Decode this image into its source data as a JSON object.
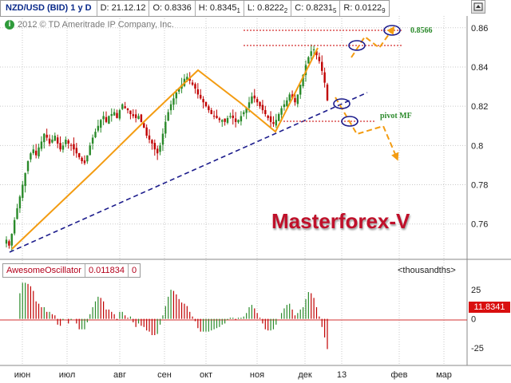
{
  "header": {
    "symbol": "NZD/USD (BID) 1 y D",
    "date": "D: 21.12.12",
    "open": "O: 0.8336",
    "high": "H: 0.8345",
    "high_sub": "1",
    "low": "L: 0.8222",
    "low_sub": "2",
    "close": "C: 0.8231",
    "close_sub": "5",
    "range": "R: 0.0122",
    "range_sub": "9"
  },
  "copyright": "2012 © TD Ameritrade IP Company, Inc.",
  "watermark": "Masterforex-V",
  "annotations": {
    "target_label": "0.8566",
    "pivot_label": "pivot MF"
  },
  "price_axis": {
    "ticks": [
      "0.86",
      "0.84",
      "0.82",
      "0.8",
      "0.78",
      "0.76"
    ]
  },
  "oscillator": {
    "name": "AwesomeOscillator",
    "value": "0.011834",
    "param": "0",
    "unit": "<thousandths>",
    "ticks": [
      "25",
      "0",
      "-25"
    ],
    "last_value": "11.8341"
  },
  "time_axis": {
    "labels": [
      "июн",
      "июл",
      "авг",
      "сен",
      "окт",
      "ноя",
      "дек",
      "13",
      "фев",
      "мар"
    ]
  },
  "colors": {
    "up_candle": "#2a8a2a",
    "down_candle": "#c00000",
    "trend_line": "#1c1c8c",
    "pattern": "#f39c12",
    "pivot_line": "#d32f2f",
    "grid": "#c9c9c9"
  },
  "chart_data": {
    "type": "candlestick",
    "symbol": "NZD/USD",
    "y_range": [
      0.742,
      0.866
    ],
    "x_months": [
      "июн",
      "июл",
      "авг",
      "сен",
      "окт",
      "ноя",
      "дек",
      "13",
      "фев",
      "мар"
    ],
    "close_series": [
      0.752,
      0.749,
      0.755,
      0.762,
      0.768,
      0.774,
      0.78,
      0.786,
      0.792,
      0.796,
      0.798,
      0.795,
      0.799,
      0.802,
      0.806,
      0.804,
      0.801,
      0.803,
      0.805,
      0.801,
      0.798,
      0.8,
      0.803,
      0.801,
      0.8,
      0.798,
      0.796,
      0.794,
      0.792,
      0.791,
      0.795,
      0.8,
      0.804,
      0.807,
      0.81,
      0.813,
      0.815,
      0.812,
      0.815,
      0.816,
      0.817,
      0.814,
      0.818,
      0.821,
      0.819,
      0.818,
      0.816,
      0.815,
      0.814,
      0.815,
      0.812,
      0.809,
      0.805,
      0.803,
      0.801,
      0.798,
      0.796,
      0.8,
      0.806,
      0.812,
      0.817,
      0.821,
      0.824,
      0.827,
      0.829,
      0.831,
      0.834,
      0.835,
      0.833,
      0.831,
      0.829,
      0.826,
      0.824,
      0.822,
      0.82,
      0.818,
      0.816,
      0.815,
      0.814,
      0.813,
      0.813,
      0.812,
      0.814,
      0.815,
      0.814,
      0.812,
      0.813,
      0.815,
      0.817,
      0.819,
      0.822,
      0.825,
      0.824,
      0.822,
      0.82,
      0.818,
      0.816,
      0.814,
      0.812,
      0.811,
      0.813,
      0.816,
      0.819,
      0.821,
      0.823,
      0.826,
      0.824,
      0.822,
      0.826,
      0.831,
      0.836,
      0.841,
      0.845,
      0.848,
      0.849,
      0.846,
      0.843,
      0.838,
      0.832,
      0.823
    ],
    "levels": {
      "target": 0.8566,
      "pivot": 0.811
    },
    "oscillator": {
      "name": "AwesomeOscillator",
      "y_range": [
        -38,
        34
      ],
      "ticks": [
        25,
        0,
        -25
      ],
      "last": 11.8341
    }
  }
}
